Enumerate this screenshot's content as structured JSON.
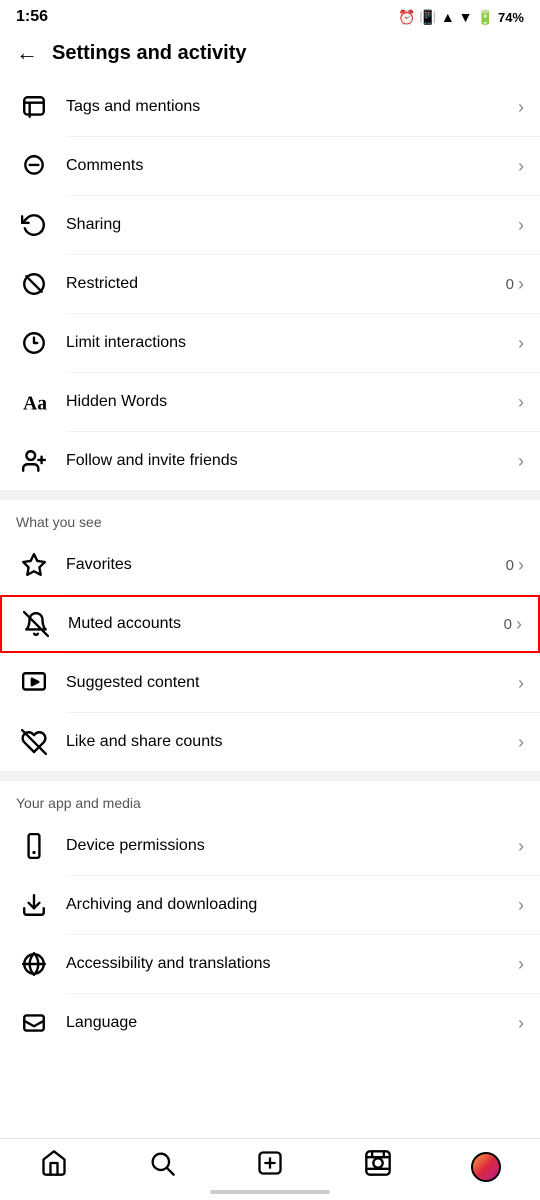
{
  "statusBar": {
    "time": "1:56",
    "battery": "74%"
  },
  "header": {
    "title": "Settings and activity",
    "backLabel": "←"
  },
  "menuSections": [
    {
      "id": "privacy",
      "label": null,
      "items": [
        {
          "id": "tags-mentions",
          "label": "Tags and mentions",
          "badge": "",
          "chevron": "›",
          "highlighted": false
        },
        {
          "id": "comments",
          "label": "Comments",
          "badge": "",
          "chevron": "›",
          "highlighted": false
        },
        {
          "id": "sharing",
          "label": "Sharing",
          "badge": "",
          "chevron": "›",
          "highlighted": false
        },
        {
          "id": "restricted",
          "label": "Restricted",
          "badge": "0",
          "chevron": "›",
          "highlighted": false
        },
        {
          "id": "limit-interactions",
          "label": "Limit interactions",
          "badge": "",
          "chevron": "›",
          "highlighted": false
        },
        {
          "id": "hidden-words",
          "label": "Hidden Words",
          "badge": "",
          "chevron": "›",
          "highlighted": false
        },
        {
          "id": "follow-invite",
          "label": "Follow and invite friends",
          "badge": "",
          "chevron": "›",
          "highlighted": false
        }
      ]
    },
    {
      "id": "what-you-see",
      "label": "What you see",
      "items": [
        {
          "id": "favorites",
          "label": "Favorites",
          "badge": "0",
          "chevron": "›",
          "highlighted": false
        },
        {
          "id": "muted-accounts",
          "label": "Muted accounts",
          "badge": "0",
          "chevron": "›",
          "highlighted": true
        },
        {
          "id": "suggested-content",
          "label": "Suggested content",
          "badge": "",
          "chevron": "›",
          "highlighted": false
        },
        {
          "id": "like-share-counts",
          "label": "Like and share counts",
          "badge": "",
          "chevron": "›",
          "highlighted": false
        }
      ]
    },
    {
      "id": "app-media",
      "label": "Your app and media",
      "items": [
        {
          "id": "device-permissions",
          "label": "Device permissions",
          "badge": "",
          "chevron": "›",
          "highlighted": false
        },
        {
          "id": "archiving-downloading",
          "label": "Archiving and downloading",
          "badge": "",
          "chevron": "›",
          "highlighted": false
        },
        {
          "id": "accessibility-translations",
          "label": "Accessibility and translations",
          "badge": "",
          "chevron": "›",
          "highlighted": false
        },
        {
          "id": "language",
          "label": "Language",
          "badge": "",
          "chevron": "›",
          "highlighted": false
        }
      ]
    }
  ],
  "bottomNav": {
    "items": [
      {
        "id": "home",
        "label": "home"
      },
      {
        "id": "search",
        "label": "search"
      },
      {
        "id": "add",
        "label": "add"
      },
      {
        "id": "reels",
        "label": "reels"
      },
      {
        "id": "profile",
        "label": "profile"
      }
    ]
  }
}
